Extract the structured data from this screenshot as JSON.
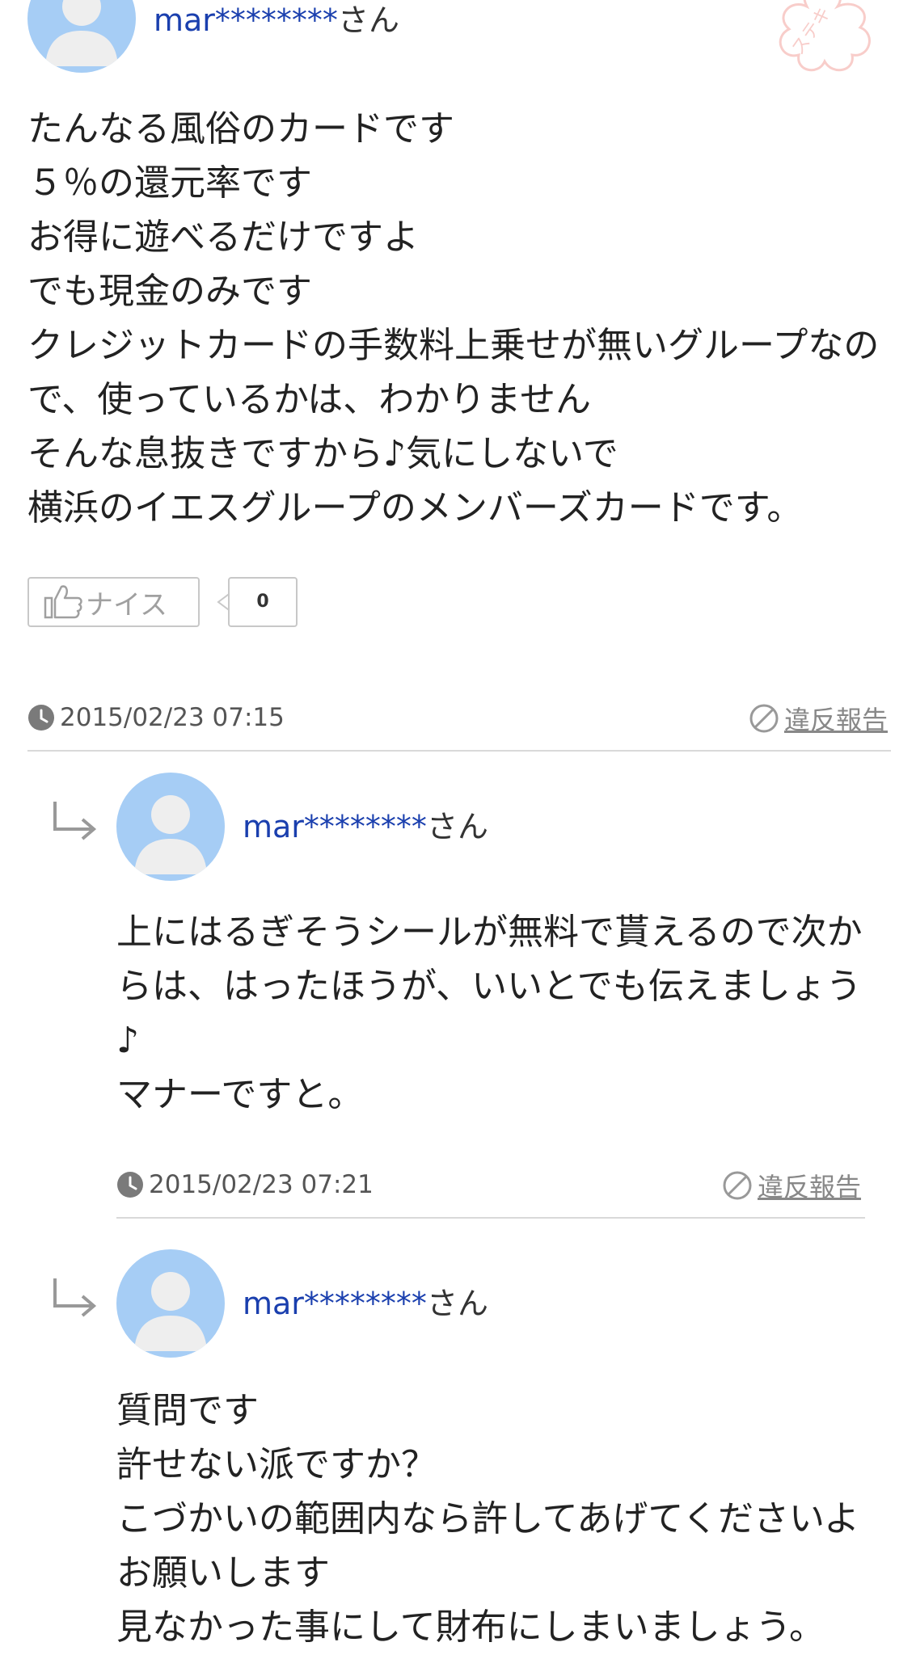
{
  "top_answer": {
    "user_id": "mar********",
    "honorific": "さん",
    "body_lines": [
      "たんなる風俗のカードです",
      "５％の還元率です",
      "お得に遊べるだけですよ",
      "でも現金のみです",
      "クレジットカードの手数料上乗せが無いグループなの",
      "で、使っているかは、わかりません",
      "そんな息抜きですから♪気にしないで",
      "横浜のイエスグループのメンバーズカードです。"
    ],
    "nice_label": "ナイス",
    "nice_count": "0",
    "timestamp": "2015/02/23 07:15",
    "report_label": "違反報告"
  },
  "replies": [
    {
      "user_id": "mar********",
      "honorific": "さん",
      "body_lines": [
        "上にはるぎそうシールが無料で貰えるので次か",
        "らは、はったほうが、いいとでも伝えましょう",
        "♪",
        "マナーですと。"
      ],
      "timestamp": "2015/02/23 07:21",
      "report_label": "違反報告"
    },
    {
      "user_id": "mar********",
      "honorific": "さん",
      "body_lines": [
        "質問です",
        "許せない派ですか？",
        "こづかいの範囲内なら許してあげてくださいよ",
        "お願いします",
        "見なかった事にして財布にしまいましょう。"
      ]
    }
  ],
  "stamp_text": "ステキ",
  "colors": {
    "username": "#1a3fae",
    "avatar": "#a6cdf5",
    "divider": "#d9d9d9",
    "stamp": "#f3a6a0"
  },
  "icons": {
    "avatar": "person-silhouette-icon",
    "reply": "reply-arrow-icon",
    "clock": "clock-icon",
    "report": "prohibited-icon",
    "nice": "thumbs-up-icon"
  }
}
